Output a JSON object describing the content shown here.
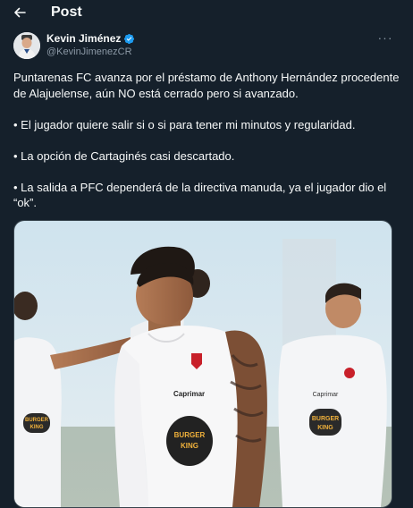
{
  "header": {
    "title": "Post"
  },
  "author": {
    "name": "Kevin Jiménez",
    "handle": "@KevinJimenezCR"
  },
  "tweet": {
    "paragraphs": [
      "Puntarenas FC avanza por el préstamo de Anthony Hernández procedente de Alajuelense, aún NO está cerrado pero si avanzado.",
      "• El jugador quiere salir si o si para tener mi minutos y regularidad.",
      "• La opción de Cartaginés casi descartado.",
      "• La salida a PFC dependerá de la directiva manuda, ya el jugador dio el “ok”."
    ]
  },
  "media": {
    "jersey_texts": [
      "Burger King",
      "BURGER",
      "KING",
      "Caprimar"
    ]
  },
  "colors": {
    "background": "#15202b",
    "text_primary": "#f7f9f9",
    "text_secondary": "#8b98a5",
    "verified": "#1d9bf0",
    "border": "#38444d"
  },
  "icons": [
    "back-arrow-icon",
    "verified-icon",
    "more-icon"
  ]
}
